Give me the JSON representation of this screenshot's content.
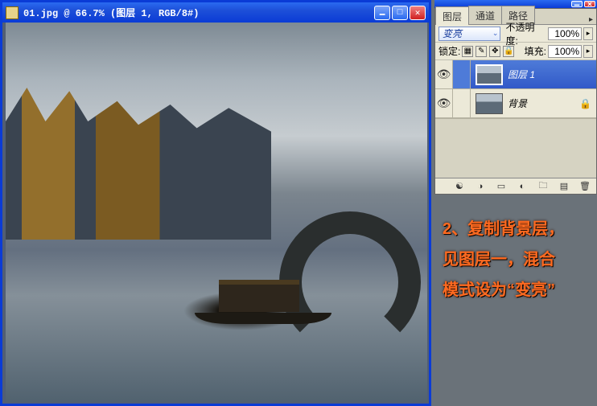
{
  "doc_window": {
    "title": "01.jpg @ 66.7% (图层 1, RGB/8#)"
  },
  "layers_panel": {
    "tabs": {
      "layers": "图层",
      "channels": "通道",
      "paths": "路径"
    },
    "blend_mode": "变亮",
    "opacity_label": "不透明度:",
    "opacity_value": "100%",
    "lock_label": "锁定:",
    "fill_label": "填充:",
    "fill_value": "100%",
    "layers": [
      {
        "name": "图层 1",
        "visible": true,
        "selected": true,
        "locked": false
      },
      {
        "name": "背景",
        "visible": true,
        "selected": false,
        "locked": true
      }
    ]
  },
  "instruction": {
    "line1": "2、复制背景层，",
    "line2": "见图层一，混合",
    "line3": "模式设为“变亮”"
  }
}
